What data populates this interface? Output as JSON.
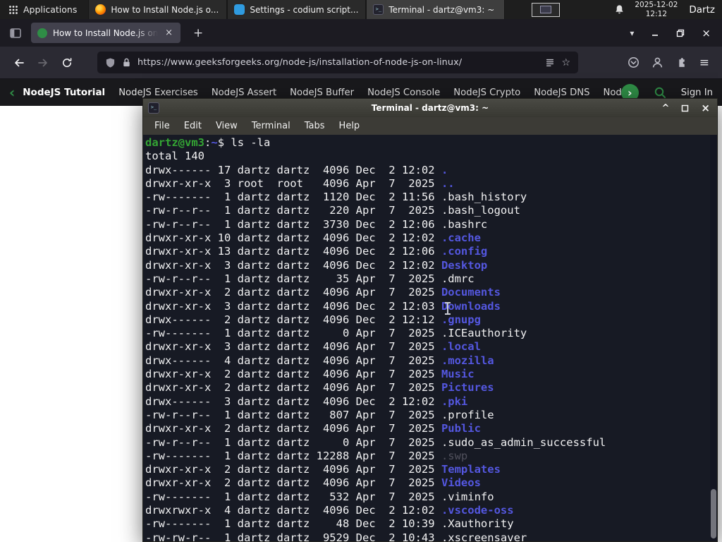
{
  "panel": {
    "applications_label": "Applications",
    "taskbar": [
      {
        "app": "firefox",
        "label": "How to Install Node.js o...",
        "active": false
      },
      {
        "app": "codium",
        "label": "Settings - codium script...",
        "active": false
      },
      {
        "app": "terminal",
        "label": "Terminal - dartz@vm3: ~",
        "active": true
      }
    ],
    "clock": {
      "date": "2025-12-02",
      "time": "12:12"
    },
    "user_label": "Dartz"
  },
  "browser": {
    "tab": {
      "title": "How to Install Node.js on"
    },
    "url": "https://www.geeksforgeeks.org/node-js/installation-of-node-js-on-linux/"
  },
  "site_nav": {
    "back_chevron": "‹",
    "forward_chevron": "›",
    "items": [
      "NodeJS Tutorial",
      "NodeJS Exercises",
      "NodeJS Assert",
      "NodeJS Buffer",
      "NodeJS Console",
      "NodeJS Crypto",
      "NodeJS DNS",
      "Node"
    ],
    "sign_in_label": "Sign In"
  },
  "terminal": {
    "title": "Terminal - dartz@vm3: ~",
    "menu": [
      "File",
      "Edit",
      "View",
      "Terminal",
      "Tabs",
      "Help"
    ],
    "prompt": {
      "user_host": "dartz@vm3",
      "colon": ":",
      "path": "~",
      "symbol": "$",
      "command": "ls -la"
    },
    "total_line": "total 140",
    "entries": [
      {
        "meta": "drwx------ 17 dartz dartz  4096 Dec  2 12:02 ",
        "name": ".",
        "type": "directory"
      },
      {
        "meta": "drwxr-xr-x  3 root  root   4096 Apr  7  2025 ",
        "name": "..",
        "type": "directory"
      },
      {
        "meta": "-rw-------  1 dartz dartz  1120 Dec  2 11:56 ",
        "name": ".bash_history",
        "type": "file"
      },
      {
        "meta": "-rw-r--r--  1 dartz dartz   220 Apr  7  2025 ",
        "name": ".bash_logout",
        "type": "file"
      },
      {
        "meta": "-rw-r--r--  1 dartz dartz  3730 Dec  2 12:06 ",
        "name": ".bashrc",
        "type": "file"
      },
      {
        "meta": "drwxr-xr-x 10 dartz dartz  4096 Dec  2 12:02 ",
        "name": ".cache",
        "type": "directory"
      },
      {
        "meta": "drwxr-xr-x 13 dartz dartz  4096 Dec  2 12:06 ",
        "name": ".config",
        "type": "directory"
      },
      {
        "meta": "drwxr-xr-x  3 dartz dartz  4096 Dec  2 12:02 ",
        "name": "Desktop",
        "type": "directory"
      },
      {
        "meta": "-rw-r--r--  1 dartz dartz    35 Apr  7  2025 ",
        "name": ".dmrc",
        "type": "file"
      },
      {
        "meta": "drwxr-xr-x  2 dartz dartz  4096 Apr  7  2025 ",
        "name": "Documents",
        "type": "directory"
      },
      {
        "meta": "drwxr-xr-x  3 dartz dartz  4096 Dec  2 12:03 ",
        "name": "Downloads",
        "type": "directory"
      },
      {
        "meta": "drwx------  2 dartz dartz  4096 Dec  2 12:12 ",
        "name": ".gnupg",
        "type": "directory"
      },
      {
        "meta": "-rw-------  1 dartz dartz     0 Apr  7  2025 ",
        "name": ".ICEauthority",
        "type": "file"
      },
      {
        "meta": "drwxr-xr-x  3 dartz dartz  4096 Apr  7  2025 ",
        "name": ".local",
        "type": "directory"
      },
      {
        "meta": "drwx------  4 dartz dartz  4096 Apr  7  2025 ",
        "name": ".mozilla",
        "type": "directory"
      },
      {
        "meta": "drwxr-xr-x  2 dartz dartz  4096 Apr  7  2025 ",
        "name": "Music",
        "type": "directory"
      },
      {
        "meta": "drwxr-xr-x  2 dartz dartz  4096 Apr  7  2025 ",
        "name": "Pictures",
        "type": "directory"
      },
      {
        "meta": "drwx------  3 dartz dartz  4096 Dec  2 12:02 ",
        "name": ".pki",
        "type": "directory"
      },
      {
        "meta": "-rw-r--r--  1 dartz dartz   807 Apr  7  2025 ",
        "name": ".profile",
        "type": "file"
      },
      {
        "meta": "drwxr-xr-x  2 dartz dartz  4096 Apr  7  2025 ",
        "name": "Public",
        "type": "directory"
      },
      {
        "meta": "-rw-r--r--  1 dartz dartz     0 Apr  7  2025 ",
        "name": ".sudo_as_admin_successful",
        "type": "file"
      },
      {
        "meta": "-rw-------  1 dartz dartz 12288 Apr  7  2025 ",
        "name": ".swp",
        "type": "dim"
      },
      {
        "meta": "drwxr-xr-x  2 dartz dartz  4096 Apr  7  2025 ",
        "name": "Templates",
        "type": "directory"
      },
      {
        "meta": "drwxr-xr-x  2 dartz dartz  4096 Apr  7  2025 ",
        "name": "Videos",
        "type": "directory"
      },
      {
        "meta": "-rw-------  1 dartz dartz   532 Apr  7  2025 ",
        "name": ".viminfo",
        "type": "file"
      },
      {
        "meta": "drwxrwxr-x  4 dartz dartz  4096 Dec  2 12:02 ",
        "name": ".vscode-oss",
        "type": "directory"
      },
      {
        "meta": "-rw-------  1 dartz dartz    48 Dec  2 10:39 ",
        "name": ".Xauthority",
        "type": "file"
      },
      {
        "meta": "-rw-rw-r--  1 dartz dartz  9529 Dec  2 10:43 ",
        "name": ".xscreensaver",
        "type": "file"
      }
    ],
    "colors": {
      "directory": "#5457e0",
      "file": "#f1f1f2",
      "dim": "#50505c",
      "prompt_user": "#34a534",
      "prompt_path": "#5457e0"
    }
  },
  "glyphs": {
    "new_tab": "+",
    "tab_list": "▾",
    "app_menu": "≡",
    "bookmark_star": "☆",
    "close": "×",
    "shade": "^",
    "terminal_icon": ">_"
  }
}
